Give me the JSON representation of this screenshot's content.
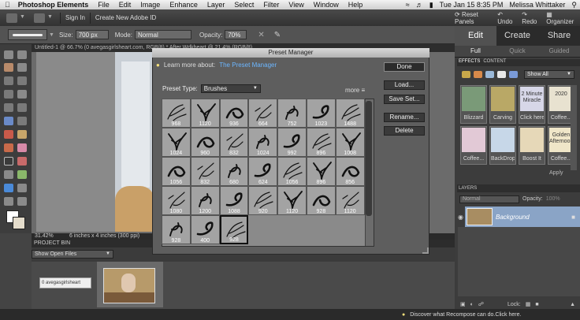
{
  "menubar": {
    "app_name": "Photoshop Elements",
    "menus": [
      "File",
      "Edit",
      "Image",
      "Enhance",
      "Layer",
      "Select",
      "Filter",
      "View",
      "Window",
      "Help"
    ],
    "datetime": "Tue Jan 15  8:35 PM",
    "user": "Melissa Whittaker"
  },
  "appbar": {
    "sign_in": "Sign In",
    "create_id": "Create New Adobe ID",
    "reset_panels": "Reset Panels",
    "undo": "Undo",
    "redo": "Redo",
    "organizer": "Organizer"
  },
  "options": {
    "size_label": "Size:",
    "size_value": "700 px",
    "mode_label": "Mode:",
    "mode_value": "Normal",
    "opacity_label": "Opacity:",
    "opacity_value": "70%"
  },
  "document": {
    "tabs": "Untitled-1 @ 66.7% (0 avegasgirlsheart.com, RGB/8) *   After Wdkheart @ 21.4% (RGB/8) ",
    "zoom": "31.42%",
    "doc_size": "6 inches x 4 inches (300 ppi)"
  },
  "project_bin": {
    "header": "PROJECT BIN",
    "dropdown": "Show Open Files",
    "item1_label": "0 avegasgirlsheart"
  },
  "dialog": {
    "title": "Preset Manager",
    "learn_label": "Learn more about:",
    "learn_link": "The Preset Manager",
    "preset_type_label": "Preset Type:",
    "preset_type_value": "Brushes",
    "more": "more",
    "buttons": {
      "done": "Done",
      "load": "Load...",
      "save": "Save Set...",
      "rename": "Rename...",
      "delete": "Delete"
    },
    "brushes": [
      "968",
      "1120",
      "936",
      "664",
      "752",
      "1023",
      "1488",
      "1024",
      "960",
      "832",
      "1024",
      "992",
      "896",
      "1008",
      "1056",
      "832",
      "680",
      "624",
      "1056",
      "896",
      "856",
      "1080",
      "1200",
      "1088",
      "920",
      "1120",
      "928",
      "1120",
      "928",
      "400",
      "928"
    ],
    "selected_index": 30
  },
  "right_panel": {
    "modes": [
      "Edit",
      "Create",
      "Share"
    ],
    "submodes": [
      "Full",
      "Quick",
      "Guided"
    ],
    "effects_tabs": [
      "EFFECTS",
      "CONTENT"
    ],
    "show_all": "Show All",
    "effects": [
      {
        "label": "Blizzard",
        "color": "#7a9a78",
        "text": ""
      },
      {
        "label": "Carving",
        "color": "#b9a866",
        "text": ""
      },
      {
        "label": "Click here",
        "color": "#d7d7e8",
        "text": "2 Minute Miracle"
      },
      {
        "label": "Coffee...",
        "color": "#e8e2d0",
        "text": "2020"
      },
      {
        "label": "Coffee...",
        "color": "#e2c9d6",
        "text": ""
      },
      {
        "label": "BackDrop Fix",
        "color": "#c7d7e8",
        "text": ""
      },
      {
        "label": "Boost It",
        "color": "#e6d8b8",
        "text": ""
      },
      {
        "label": "Coffee...",
        "color": "#efe6c8",
        "text": "Golden Afternoon"
      }
    ],
    "apply": "Apply",
    "layers_header": "LAYERS",
    "blend_mode": "Normal",
    "opacity_label": "Opacity:",
    "opacity_value": "100%",
    "layer_name": "Background",
    "lock_label": "Lock:"
  },
  "bottom": {
    "tip": "Discover what Recompose can do.Click here."
  },
  "colors": {
    "link": "#6cb6ff",
    "layer_selected": "#8aa4c6"
  }
}
